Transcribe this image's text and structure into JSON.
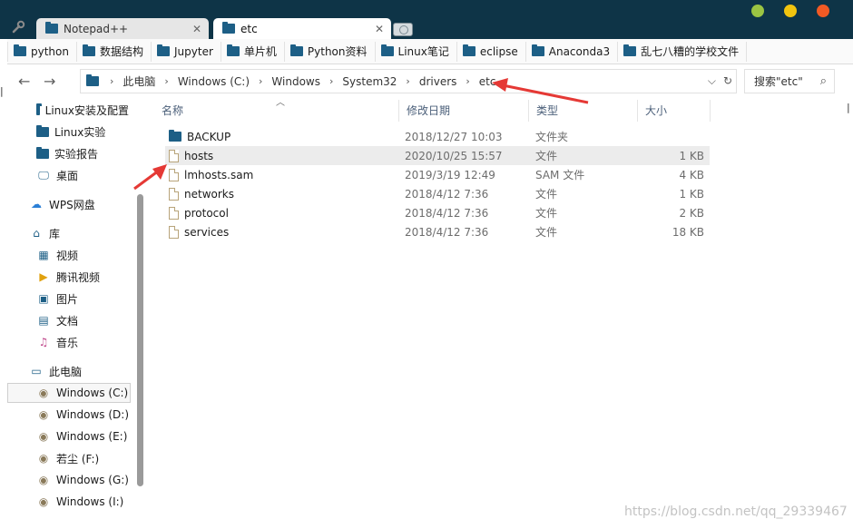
{
  "colors": {
    "titlebar": "#0e3447",
    "folder": "#1d5f86",
    "arrow": "#e53935",
    "dot_green": "#9bc443",
    "dot_yellow": "#f1c40f",
    "dot_orange": "#f15a24"
  },
  "tabs": [
    {
      "label": "Notepad++",
      "active": false
    },
    {
      "label": "etc",
      "active": true
    }
  ],
  "bookmarks": [
    "python",
    "数据结构",
    "Jupyter",
    "单片机",
    "Python资料",
    "Linux笔记",
    "eclipse",
    "Anaconda3",
    "乱七八糟的学校文件"
  ],
  "address": {
    "crumbs": [
      "此电脑",
      "Windows (C:)",
      "Windows",
      "System32",
      "drivers",
      "etc"
    ]
  },
  "search": {
    "placeholder": "搜索\"etc\""
  },
  "sidebar": {
    "items": [
      {
        "label": "Linux安装及配置",
        "icon": "folder-icon"
      },
      {
        "label": "Linux实验",
        "icon": "folder-icon"
      },
      {
        "label": "实验报告",
        "icon": "folder-icon"
      },
      {
        "label": "桌面",
        "icon": "desktop-icon"
      },
      {
        "label": "WPS网盘",
        "icon": "cloud-icon"
      },
      {
        "label": "库",
        "icon": "library-icon"
      },
      {
        "label": "视频",
        "icon": "video-icon"
      },
      {
        "label": "腾讯视频",
        "icon": "tencent-video-icon"
      },
      {
        "label": "图片",
        "icon": "picture-icon"
      },
      {
        "label": "文档",
        "icon": "document-icon"
      },
      {
        "label": "音乐",
        "icon": "music-icon"
      },
      {
        "label": "此电脑",
        "icon": "computer-icon"
      },
      {
        "label": "Windows (C:)",
        "icon": "drive-icon"
      },
      {
        "label": "Windows (D:)",
        "icon": "drive-icon"
      },
      {
        "label": "Windows (E:)",
        "icon": "drive-icon"
      },
      {
        "label": "若尘 (F:)",
        "icon": "drive-icon"
      },
      {
        "label": "Windows (G:)",
        "icon": "drive-icon"
      },
      {
        "label": "Windows (I:)",
        "icon": "drive-icon"
      }
    ]
  },
  "columns": [
    "名称",
    "修改日期",
    "类型",
    "大小"
  ],
  "files": [
    {
      "name": "BACKUP",
      "date": "2018/12/27 10:03",
      "type": "文件夹",
      "size": "",
      "icon": "folder-icon"
    },
    {
      "name": "hosts",
      "date": "2020/10/25 15:57",
      "type": "文件",
      "size": "1 KB",
      "icon": "file-icon"
    },
    {
      "name": "lmhosts.sam",
      "date": "2019/3/19 12:49",
      "type": "SAM 文件",
      "size": "4 KB",
      "icon": "file-icon"
    },
    {
      "name": "networks",
      "date": "2018/4/12 7:36",
      "type": "文件",
      "size": "1 KB",
      "icon": "file-icon"
    },
    {
      "name": "protocol",
      "date": "2018/4/12 7:36",
      "type": "文件",
      "size": "2 KB",
      "icon": "file-icon"
    },
    {
      "name": "services",
      "date": "2018/4/12 7:36",
      "type": "文件",
      "size": "18 KB",
      "icon": "file-icon"
    }
  ],
  "watermark": "https://blog.csdn.net/qq_29339467"
}
